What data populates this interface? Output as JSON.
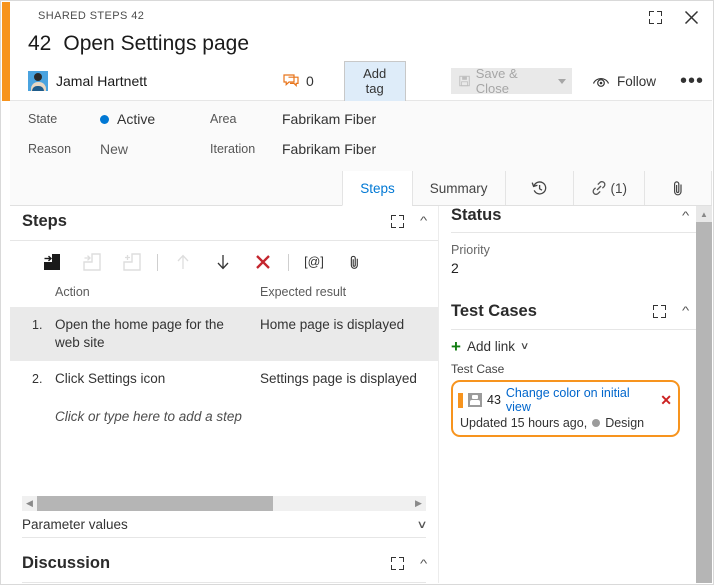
{
  "header": {
    "breadcrumb": "SHARED STEPS 42",
    "work_item_id": "42",
    "work_item_title": "Open Settings page",
    "assigned_to": "Jamal Hartnett",
    "discussion_count": "0",
    "add_tag_label": "Add tag",
    "save_close_label": "Save & Close",
    "follow_label": "Follow",
    "ellipsis_label": "•••",
    "accent_color": "#f7941e"
  },
  "fields": {
    "state_label": "State",
    "state_value": "Active",
    "state_color": "#0078d4",
    "reason_label": "Reason",
    "reason_value": "New",
    "area_label": "Area",
    "area_value": "Fabrikam Fiber",
    "iteration_label": "Iteration",
    "iteration_value": "Fabrikam Fiber"
  },
  "tabs": [
    {
      "label": "Steps",
      "active": true
    },
    {
      "label": "Summary",
      "active": false
    },
    {
      "label": "↺",
      "active": false
    },
    {
      "label": "(1)",
      "active": false
    },
    {
      "label": "",
      "active": false
    }
  ],
  "steps_panel": {
    "title": "Steps",
    "toolbar": [
      {
        "name": "insert-step-icon",
        "enabled": true
      },
      {
        "name": "insert-shared-steps-icon",
        "enabled": false
      },
      {
        "name": "create-shared-steps-icon",
        "enabled": false
      },
      {
        "name": "move-up-icon",
        "enabled": false
      },
      {
        "name": "move-down-icon",
        "enabled": true
      },
      {
        "name": "delete-step-icon",
        "enabled": true
      },
      {
        "name": "insert-parameter-icon",
        "enabled": true,
        "text": "[@]"
      },
      {
        "name": "attach-file-icon",
        "enabled": true
      }
    ],
    "columns": {
      "num": "",
      "action": "Action",
      "expected": "Expected result"
    },
    "rows": [
      {
        "num": "1.",
        "action": "Open the home page for the web site",
        "expected": "Home page is displayed",
        "selected": true
      },
      {
        "num": "2.",
        "action": "Click Settings icon",
        "expected": "Settings page is displayed",
        "selected": false
      }
    ],
    "add_step_placeholder": "Click or type here to add a step",
    "parameter_values_label": "Parameter values",
    "discussion_label": "Discussion"
  },
  "status_panel": {
    "title": "Status",
    "priority_label": "Priority",
    "priority_value": "2"
  },
  "test_cases_panel": {
    "title": "Test Cases",
    "add_link_label": "Add link",
    "group_label": "Test Case",
    "items": [
      {
        "id": "43",
        "title": "Change color on initial view",
        "meta": "Updated 15 hours ago,",
        "state": "Design",
        "highlight_color": "#f7941e"
      }
    ]
  }
}
